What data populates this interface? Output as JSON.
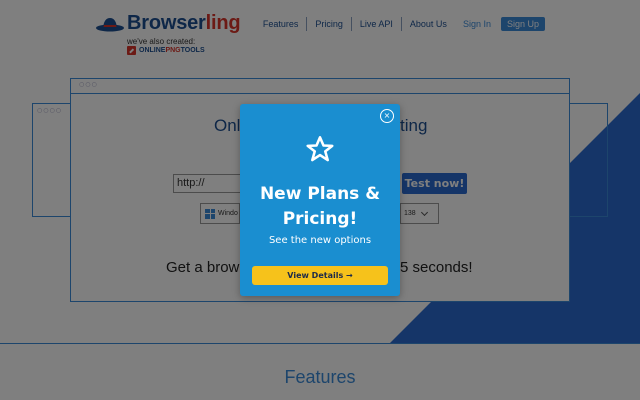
{
  "brand": {
    "logo_text_blue": "Browser",
    "logo_text_red": "ling",
    "also_created": "we've also created:",
    "partner_part1": "ONLINE",
    "partner_part2": "PNG",
    "partner_part3": "TOOLS"
  },
  "nav": {
    "items": [
      {
        "label": "Features"
      },
      {
        "label": "Pricing"
      },
      {
        "label": "Live API"
      },
      {
        "label": "About Us"
      }
    ],
    "sign_in": "Sign In",
    "sign_up": "Sign Up"
  },
  "hero": {
    "title_left": "Onl",
    "title_right": "ting",
    "url_value": "http://",
    "test_button": "Test now!",
    "os_selected": "Windo",
    "version_selected": "138",
    "tagline_left": "Get a brow",
    "tagline_right": "5 seconds!"
  },
  "features_heading": "Features",
  "modal": {
    "close_symbol": "×",
    "title": "New Plans & Pricing!",
    "subtitle": "See the new options",
    "cta": "View Details →"
  },
  "colors": {
    "accent_blue": "#1a8ed0",
    "brand_blue": "#1d4f91",
    "brand_red": "#d8342b",
    "cta_yellow": "#f6c21b"
  }
}
